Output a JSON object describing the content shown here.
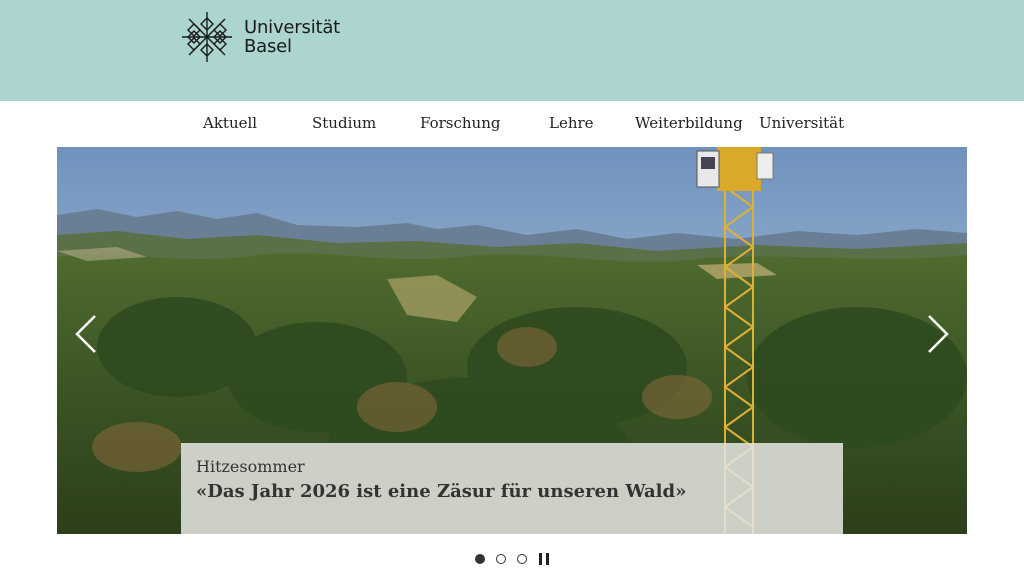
{
  "header": {
    "logo_line1": "Universität",
    "logo_line2": "Basel",
    "logo_icon": "unibas-star-logo-icon",
    "background_color": "#acd5d0"
  },
  "nav": {
    "items": [
      {
        "label": "Aktuell"
      },
      {
        "label": "Studium"
      },
      {
        "label": "Forschung"
      },
      {
        "label": "Lehre"
      },
      {
        "label": "Weiterbildung"
      },
      {
        "label": "Universität"
      }
    ]
  },
  "carousel": {
    "prev_icon": "chevron-left-icon",
    "next_icon": "chevron-right-icon",
    "slide": {
      "kicker": "Hitzesommer",
      "title": "«Das Jahr 2026 ist eine Zäsur für unseren Wald»"
    },
    "dots_total": 3,
    "active_dot": 1,
    "pause_icon": "pause-icon"
  }
}
